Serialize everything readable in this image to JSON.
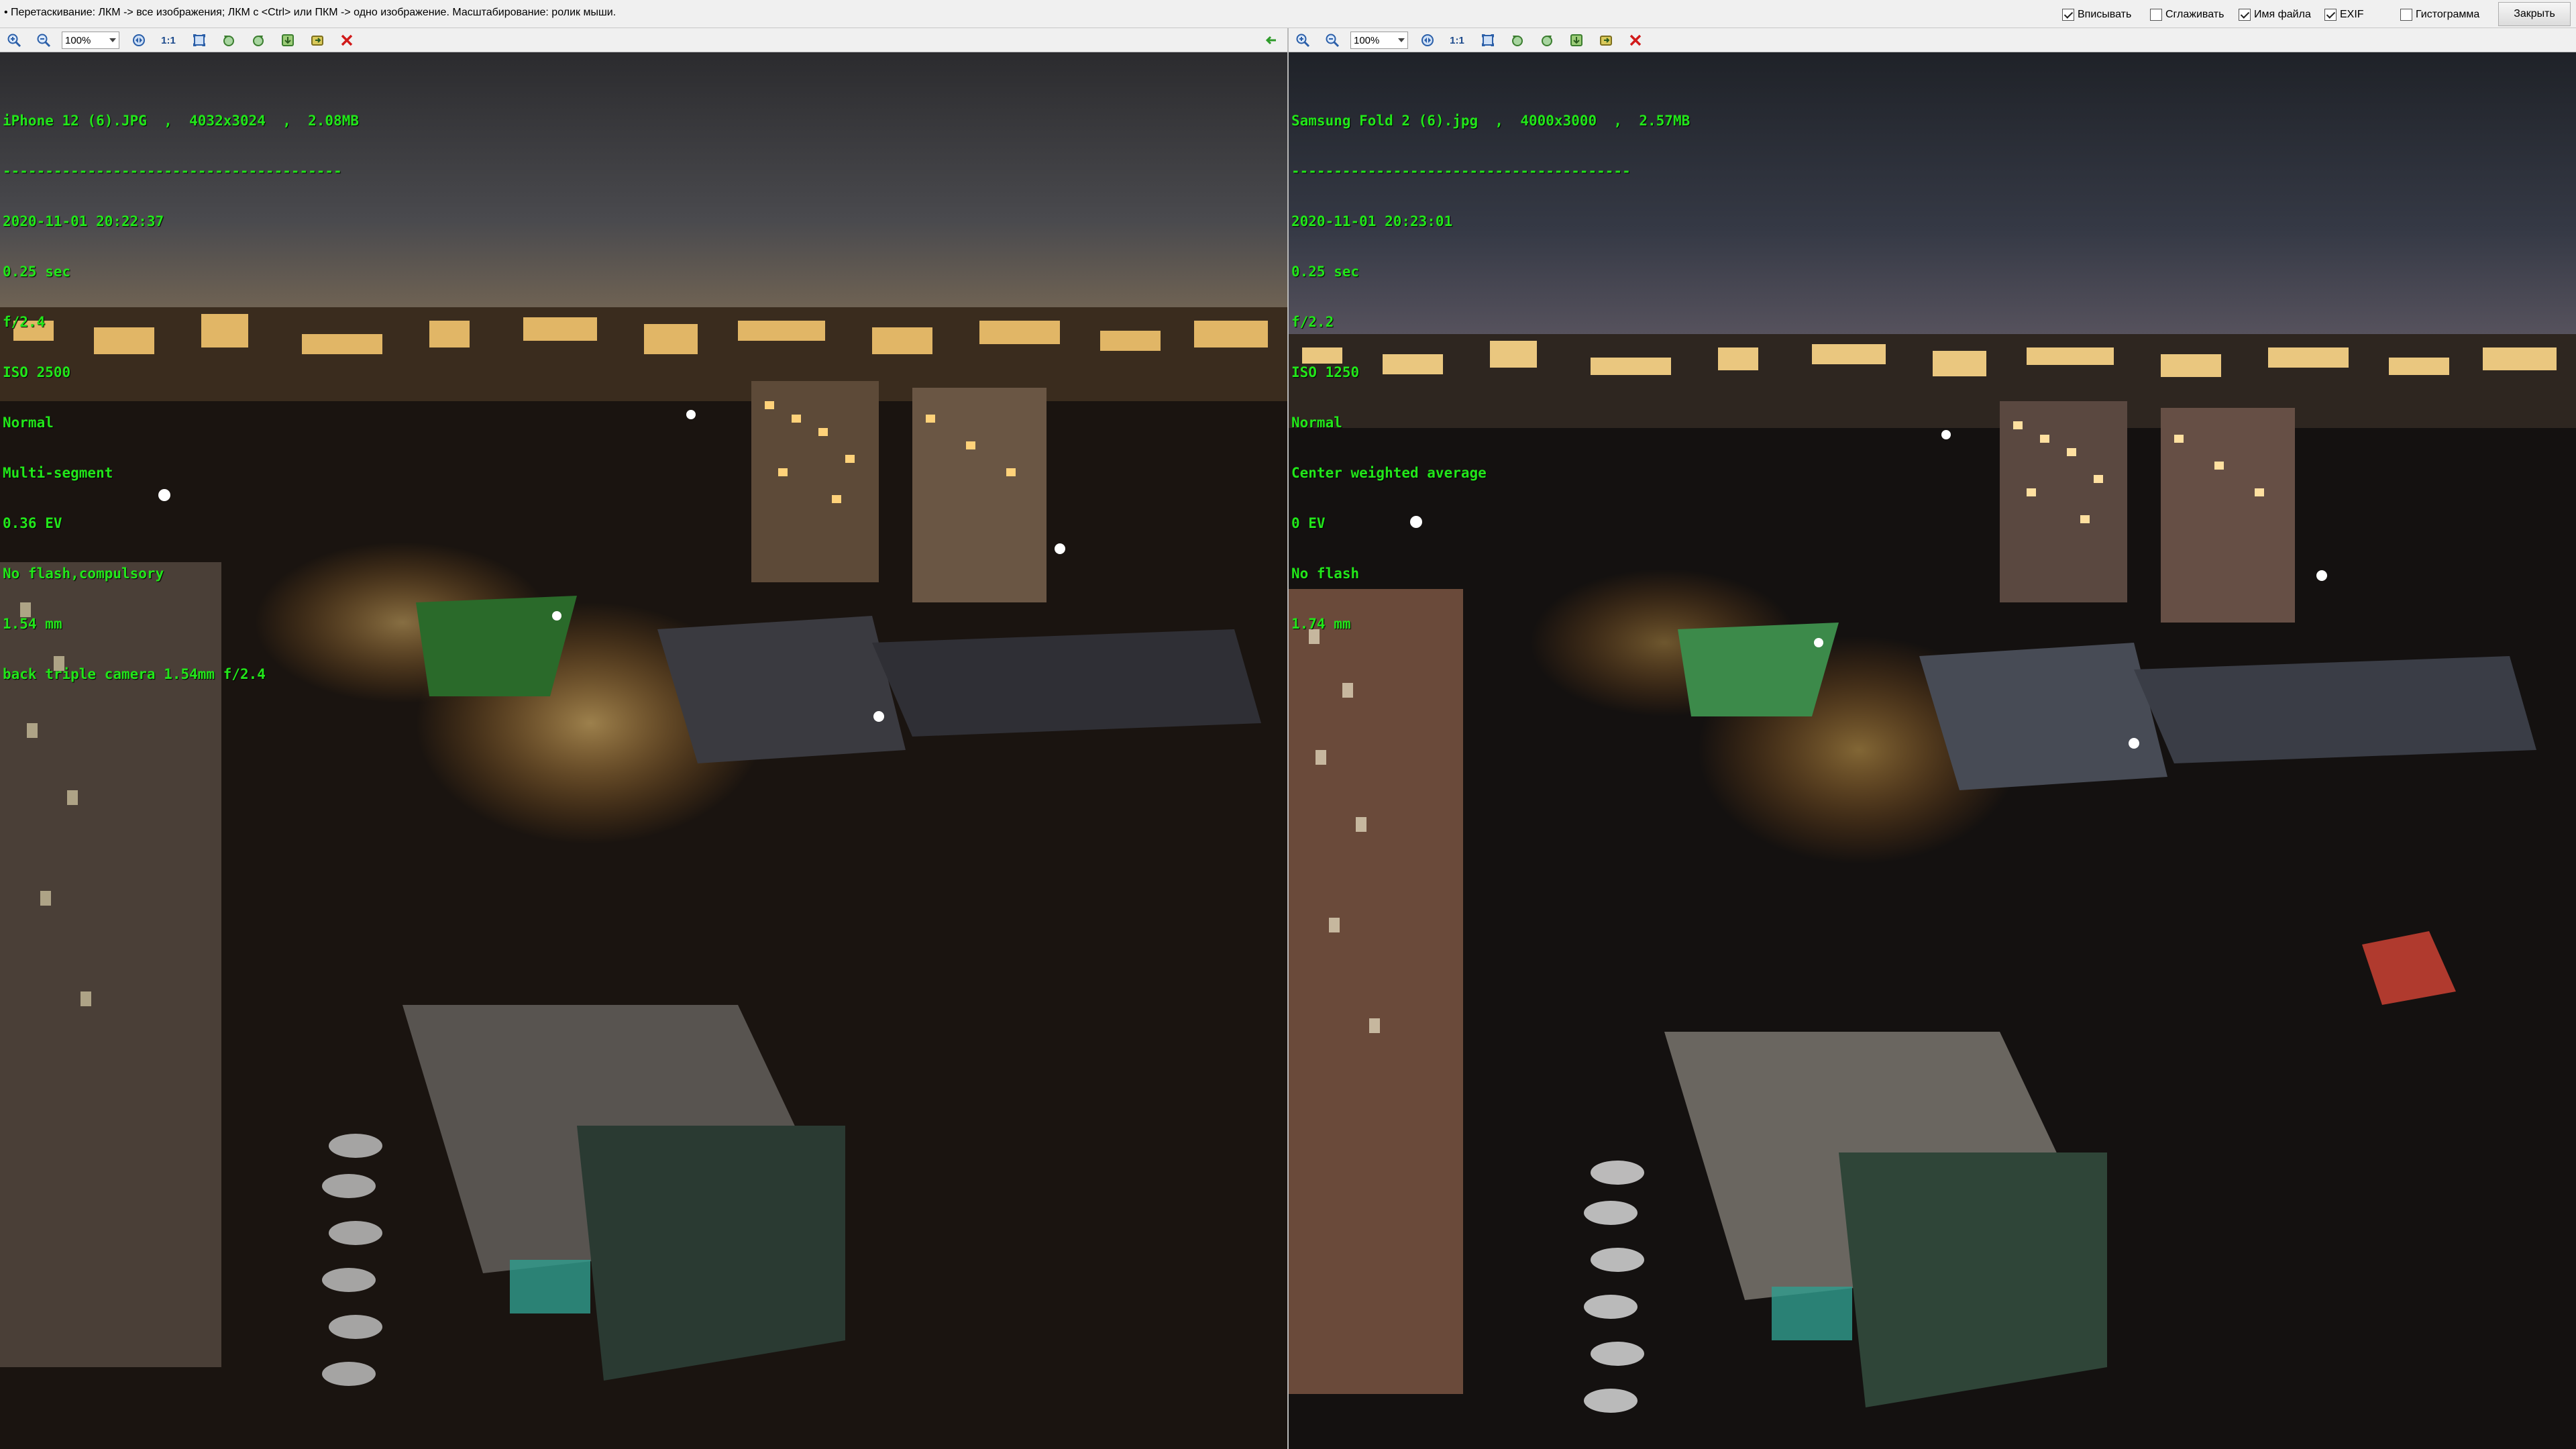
{
  "topbar": {
    "hint": "• Перетаскивание: ЛКМ -> все изображения; ЛКМ с <Ctrl> или ПКМ -> одно изображение. Масштабирование: ролик мыши.",
    "options": [
      {
        "label": "Вписывать",
        "checked": true
      },
      {
        "label": "Сглаживать",
        "checked": false
      },
      {
        "label": "Имя файла",
        "checked": true
      },
      {
        "label": "EXIF",
        "checked": true
      },
      {
        "label": "Гистограмма",
        "checked": false
      }
    ],
    "close_label": "Закрыть"
  },
  "toolbar": {
    "zoom_value": "100%",
    "one_to_one": "1:1"
  },
  "left": {
    "filename_line": "iPhone 12 (6).JPG  ,  4032x3024  ,  2.08MB",
    "separator": "----------------------------------------",
    "exif": [
      "2020-11-01 20:22:37",
      "0.25 sec",
      "f/2.4",
      "ISO 2500",
      "Normal",
      "Multi-segment",
      "0.36 EV",
      "No flash,compulsory",
      "1.54 mm",
      "back triple camera 1.54mm f/2.4"
    ]
  },
  "right": {
    "filename_line": "Samsung Fold 2 (6).jpg  ,  4000x3000  ,  2.57MB",
    "separator": "----------------------------------------",
    "exif": [
      "2020-11-01 20:23:01",
      "0.25 sec",
      "f/2.2",
      "ISO 1250",
      "Normal",
      "Center weighted average",
      "0 EV",
      "No flash",
      "1.74 mm"
    ]
  },
  "colors": {
    "exif_text": "#22e61a",
    "sky": "#3a3a40",
    "city_lights": "#ffb347"
  }
}
